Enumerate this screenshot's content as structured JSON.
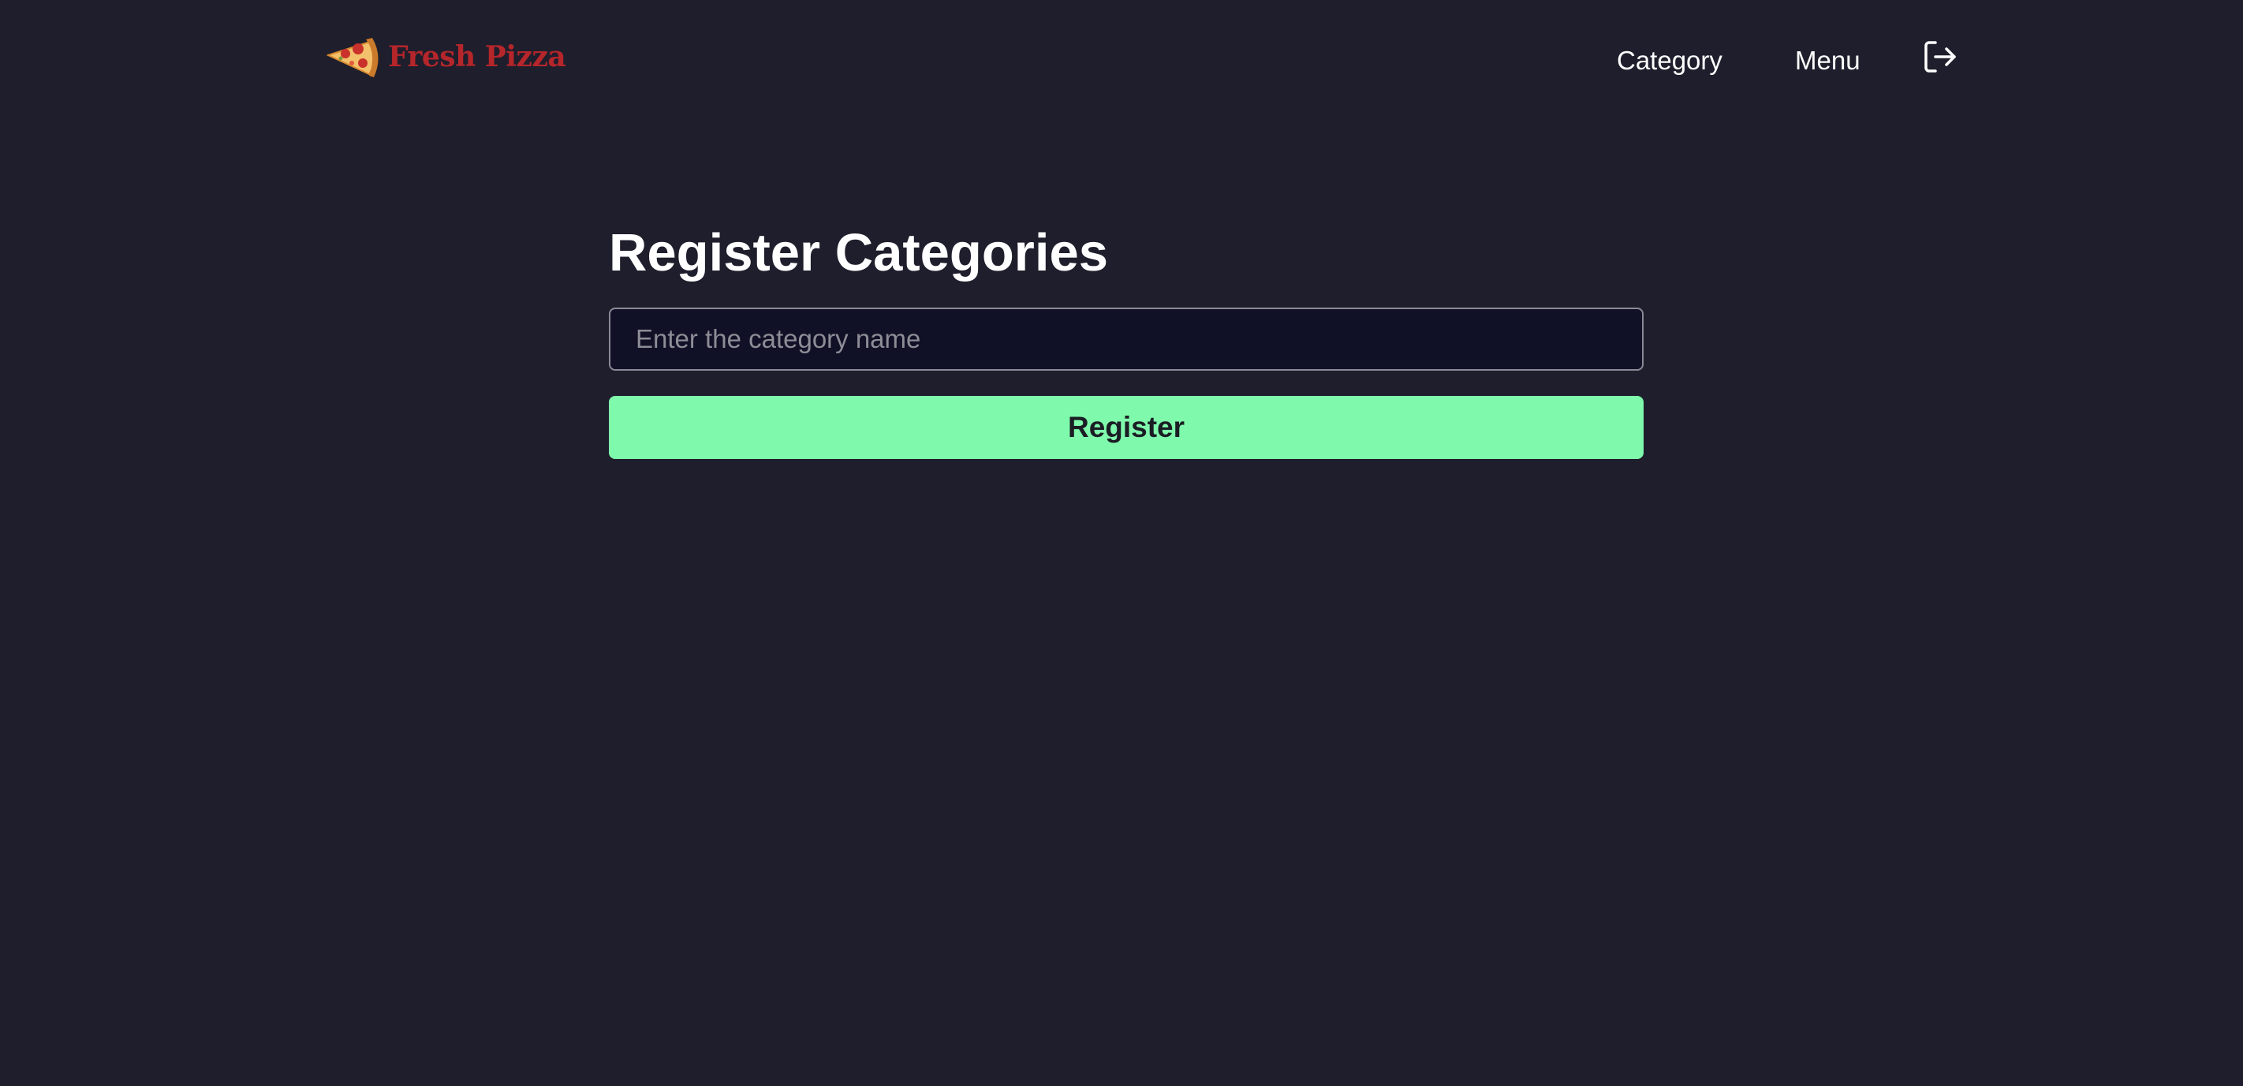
{
  "header": {
    "brand": "Fresh Pizza",
    "logo_icon": "pizza-slice-icon",
    "nav": {
      "category": "Category",
      "menu": "Menu"
    },
    "logout_icon": "logout-icon"
  },
  "main": {
    "title": "Register Categories",
    "input_placeholder": "Enter the category name",
    "input_value": "",
    "register_label": "Register"
  },
  "colors": {
    "background": "#1f1e2c",
    "brand": "#b5262b",
    "accent": "#7ffaac",
    "input_background": "#101026"
  }
}
